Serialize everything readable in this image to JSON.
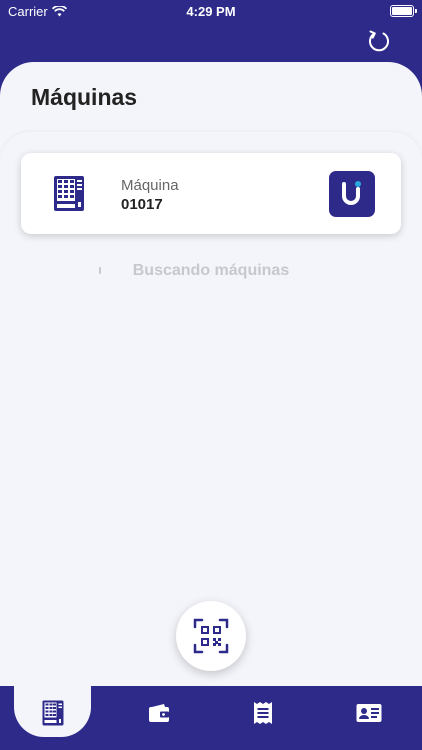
{
  "status_bar": {
    "carrier": "Carrier",
    "time": "4:29 PM"
  },
  "header": {
    "title": "Máquinas"
  },
  "machine_card": {
    "label": "Máquina",
    "number": "01017"
  },
  "search_status": "Buscando máquinas",
  "tabs": [
    {
      "icon": "vending-machine-icon",
      "active": true
    },
    {
      "icon": "wallet-icon",
      "active": false
    },
    {
      "icon": "receipt-icon",
      "active": false
    },
    {
      "icon": "id-card-icon",
      "active": false
    }
  ],
  "colors": {
    "primary": "#2d2a8a",
    "background": "#f4f5fa",
    "accent": "#2aa8e0"
  }
}
